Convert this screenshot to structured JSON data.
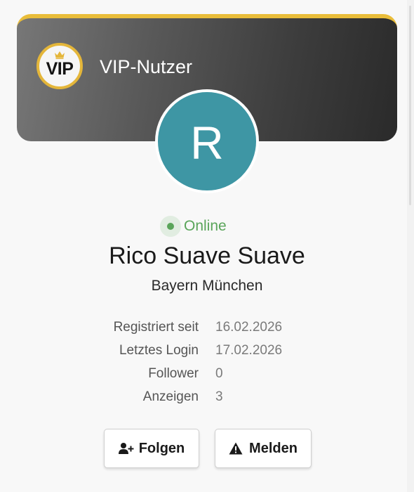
{
  "vip": {
    "badge_text": "VIP",
    "title": "VIP-Nutzer",
    "accent_color": "#e9bd3a"
  },
  "avatar": {
    "initial": "R",
    "color": "#3e96a4"
  },
  "status": {
    "label": "Online",
    "color": "#5aa55a"
  },
  "user": {
    "name": "Rico Suave Suave",
    "location": "Bayern München"
  },
  "info": {
    "rows": [
      {
        "label": "Registriert seit",
        "value": "16.02.2026"
      },
      {
        "label": "Letztes Login",
        "value": "17.02.2026"
      },
      {
        "label": "Follower",
        "value": "0"
      },
      {
        "label": "Anzeigen",
        "value": "3"
      }
    ]
  },
  "actions": {
    "follow_label": "Folgen",
    "follow_icon": "user-plus-icon",
    "report_label": "Melden",
    "report_icon": "warning-triangle-icon"
  }
}
